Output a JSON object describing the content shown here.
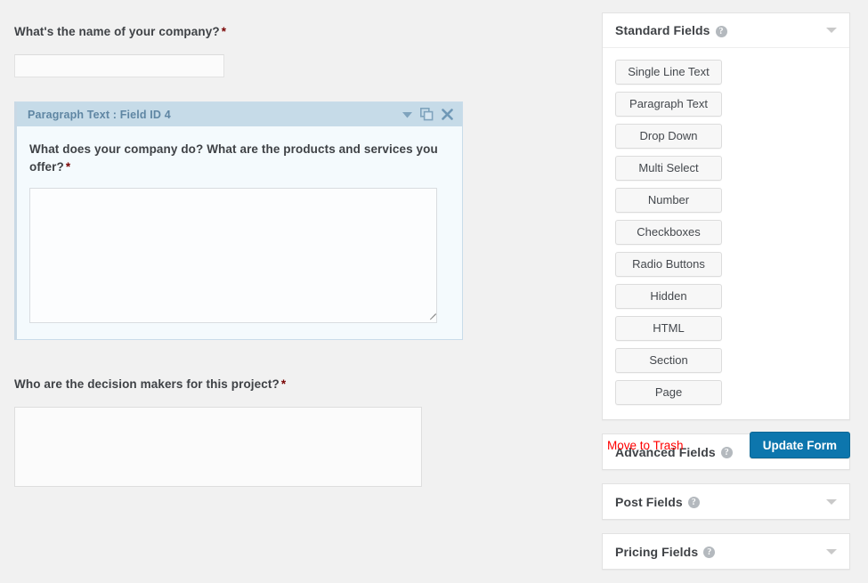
{
  "form": {
    "fields": [
      {
        "label": "What's the name of your company?",
        "required_marker": "*",
        "input_value": "",
        "input_placeholder": ""
      },
      {
        "header_title": "Paragraph Text : Field ID 4",
        "label": "What does your company do? What are the products and services you offer?",
        "required_marker": "*",
        "textarea_value": "",
        "textarea_placeholder": "",
        "tools": {
          "collapse": "chevron-down-icon",
          "duplicate": "duplicate-icon",
          "delete": "close-icon"
        }
      },
      {
        "label": "Who are the decision makers for this project?",
        "required_marker": "*",
        "textarea_value": "",
        "textarea_placeholder": ""
      }
    ]
  },
  "sidebar": {
    "panels": [
      {
        "title": "Standard Fields",
        "help": "?",
        "expanded": true,
        "buttons": [
          "Single Line Text",
          "Paragraph Text",
          "Drop Down",
          "Multi Select",
          "Number",
          "Checkboxes",
          "Radio Buttons",
          "Hidden",
          "HTML",
          "Section",
          "Page"
        ]
      },
      {
        "title": "Advanced Fields",
        "help": "?",
        "expanded": false,
        "buttons": []
      },
      {
        "title": "Post Fields",
        "help": "?",
        "expanded": false,
        "buttons": []
      },
      {
        "title": "Pricing Fields",
        "help": "?",
        "expanded": false,
        "buttons": []
      }
    ],
    "actions": {
      "trash_label": "Move to Trash",
      "update_label": "Update Form"
    }
  },
  "colors": {
    "accent_blue": "#0d76ad",
    "selected_field_header": "#c6dbe8",
    "selected_field_body": "#f4fafd",
    "danger_red": "#ff0000",
    "required_star": "#790000",
    "page_background": "#f1f1f1"
  }
}
